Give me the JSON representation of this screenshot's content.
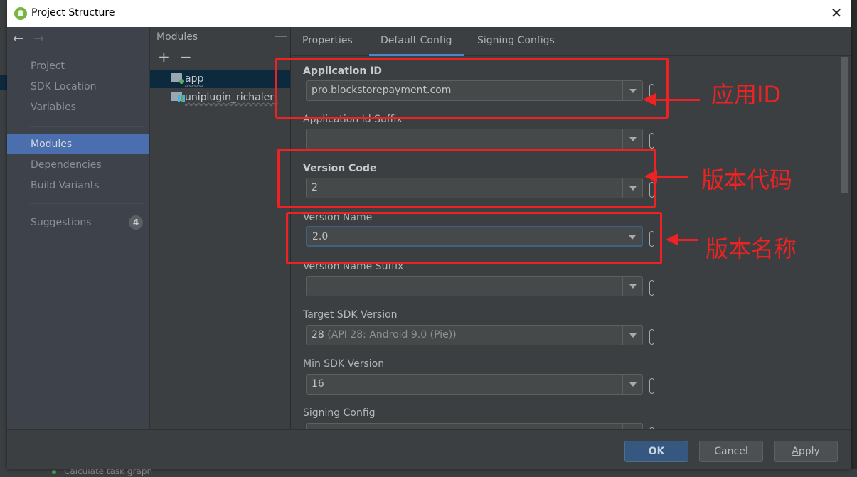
{
  "window": {
    "title": "Project Structure",
    "close_icon": "close-icon",
    "app_icon": "android-studio-icon"
  },
  "sidebar": {
    "back_icon": "arrow-left-icon",
    "forward_icon": "arrow-right-icon",
    "items": [
      {
        "label": "Project",
        "active": false
      },
      {
        "label": "SDK Location",
        "active": false
      },
      {
        "label": "Variables",
        "active": false
      },
      {
        "label": "Modules",
        "active": true
      },
      {
        "label": "Dependencies",
        "active": false
      },
      {
        "label": "Build Variants",
        "active": false
      },
      {
        "label": "Suggestions",
        "active": false,
        "badge": "4"
      }
    ]
  },
  "modules_panel": {
    "header": "Modules",
    "collapse_icon": "minus-icon",
    "add_icon": "plus-icon",
    "remove_icon": "minus-icon",
    "items": [
      {
        "label": "app",
        "icon": "app-module-folder-icon",
        "selected": true
      },
      {
        "label": "uniplugin_richalert",
        "icon": "library-module-folder-icon",
        "selected": false
      }
    ]
  },
  "tabs": [
    {
      "label": "Properties",
      "active": false
    },
    {
      "label": "Default Config",
      "active": true
    },
    {
      "label": "Signing Configs",
      "active": false
    }
  ],
  "fields": [
    {
      "label": "Application ID",
      "bold": true,
      "value": "pro.blockstorepayment.com",
      "value_dim": ""
    },
    {
      "label": "Application Id Suffix",
      "bold": false,
      "value": "",
      "value_dim": ""
    },
    {
      "label": "Version Code",
      "bold": true,
      "value": "2",
      "value_dim": ""
    },
    {
      "label": "Version Name",
      "bold": false,
      "value": "2.0",
      "value_dim": "",
      "focused": true
    },
    {
      "label": "Version Name Suffix",
      "bold": false,
      "value": "",
      "value_dim": ""
    },
    {
      "label": "Target SDK Version",
      "bold": false,
      "value": "28",
      "value_dim": " (API 28: Android 9.0 (Pie))"
    },
    {
      "label": "Min SDK Version",
      "bold": false,
      "value": "16",
      "value_dim": ""
    },
    {
      "label": "Signing Config",
      "bold": false,
      "value": "",
      "value_dim": ""
    }
  ],
  "footer": {
    "ok": "OK",
    "cancel": "Cancel",
    "apply_mnemonic": "A",
    "apply_rest": "pply"
  },
  "annotations": {
    "color": "#ee2222",
    "labels": [
      "应用ID",
      "版本代码",
      "版本名称"
    ]
  },
  "background": {
    "status_text": "Calculate task graph"
  }
}
